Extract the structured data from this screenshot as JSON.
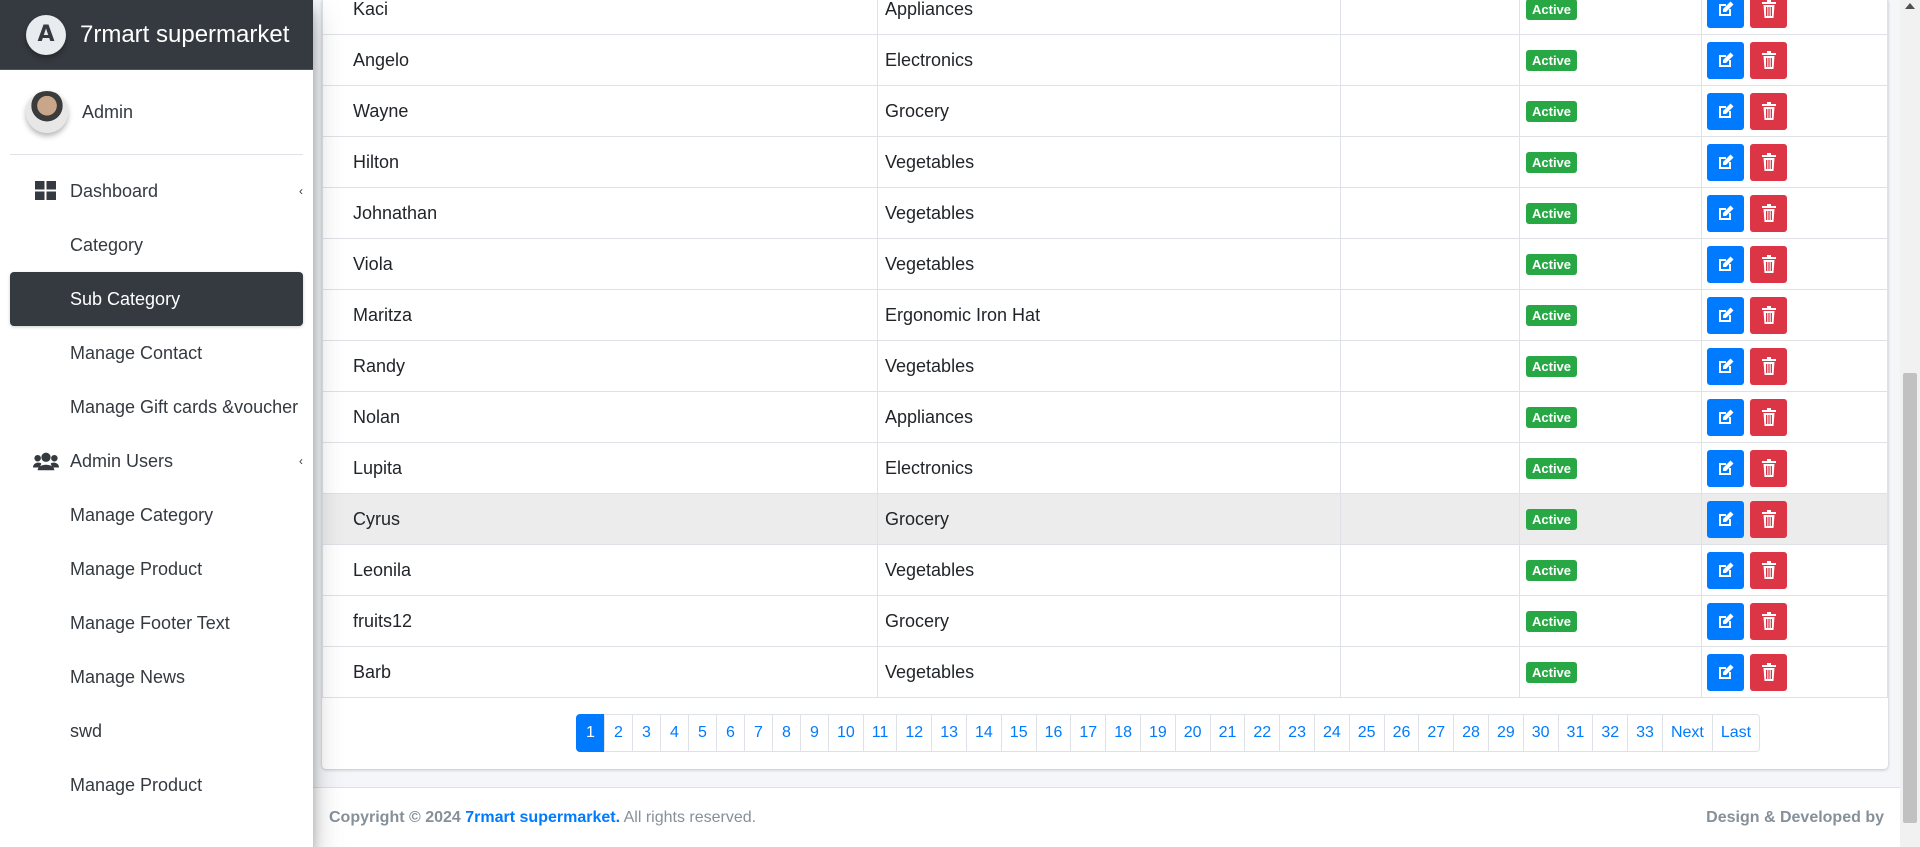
{
  "app": {
    "brand": "7rmart supermarket",
    "brand_logo_letter": "A",
    "user": "Admin"
  },
  "sidebar": {
    "items": [
      {
        "label": "Dashboard",
        "type": "parent",
        "icon": "dashboard-icon"
      },
      {
        "label": "Category",
        "type": "child"
      },
      {
        "label": "Sub Category",
        "type": "child",
        "active": true
      },
      {
        "label": "Manage Contact",
        "type": "child"
      },
      {
        "label": "Manage Gift cards &voucher",
        "type": "child"
      },
      {
        "label": "Admin Users",
        "type": "parent",
        "icon": "users-icon"
      },
      {
        "label": "Manage Category",
        "type": "child"
      },
      {
        "label": "Manage Product",
        "type": "child"
      },
      {
        "label": "Manage Footer Text",
        "type": "child"
      },
      {
        "label": "Manage News",
        "type": "child"
      },
      {
        "label": "swd",
        "type": "child"
      },
      {
        "label": "Manage Product",
        "type": "child"
      }
    ]
  },
  "table": {
    "rows": [
      {
        "name": "Kaci",
        "category": "Appliances",
        "status": "Active"
      },
      {
        "name": "Angelo",
        "category": "Electronics",
        "status": "Active"
      },
      {
        "name": "Wayne",
        "category": "Grocery",
        "status": "Active"
      },
      {
        "name": "Hilton",
        "category": "Vegetables",
        "status": "Active"
      },
      {
        "name": "Johnathan",
        "category": "Vegetables",
        "status": "Active"
      },
      {
        "name": "Viola",
        "category": "Vegetables",
        "status": "Active"
      },
      {
        "name": "Maritza",
        "category": "Ergonomic Iron Hat",
        "status": "Active"
      },
      {
        "name": "Randy",
        "category": "Vegetables",
        "status": "Active"
      },
      {
        "name": "Nolan",
        "category": "Appliances",
        "status": "Active"
      },
      {
        "name": "Lupita",
        "category": "Electronics",
        "status": "Active"
      },
      {
        "name": "Cyrus",
        "category": "Grocery",
        "status": "Active",
        "hover": true
      },
      {
        "name": "Leonila",
        "category": "Vegetables",
        "status": "Active"
      },
      {
        "name": "fruits12",
        "category": "Grocery",
        "status": "Active"
      },
      {
        "name": "Barb",
        "category": "Vegetables",
        "status": "Active"
      }
    ]
  },
  "pagination": {
    "pages": [
      "1",
      "2",
      "3",
      "4",
      "5",
      "6",
      "7",
      "8",
      "9",
      "10",
      "11",
      "12",
      "13",
      "14",
      "15",
      "16",
      "17",
      "18",
      "19",
      "20",
      "21",
      "22",
      "23",
      "24",
      "25",
      "26",
      "27",
      "28",
      "29",
      "30",
      "31",
      "32",
      "33"
    ],
    "current": "1",
    "next_label": "Next",
    "last_label": "Last"
  },
  "footer": {
    "copyright_prefix": "Copyright © 2024",
    "company": "7rmart supermarket.",
    "rights": "All rights reserved.",
    "credit": "Design & Developed by"
  },
  "colors": {
    "primary": "#007bff",
    "success": "#28a745",
    "danger": "#dc3545",
    "sidebar_dark": "#343a40"
  }
}
